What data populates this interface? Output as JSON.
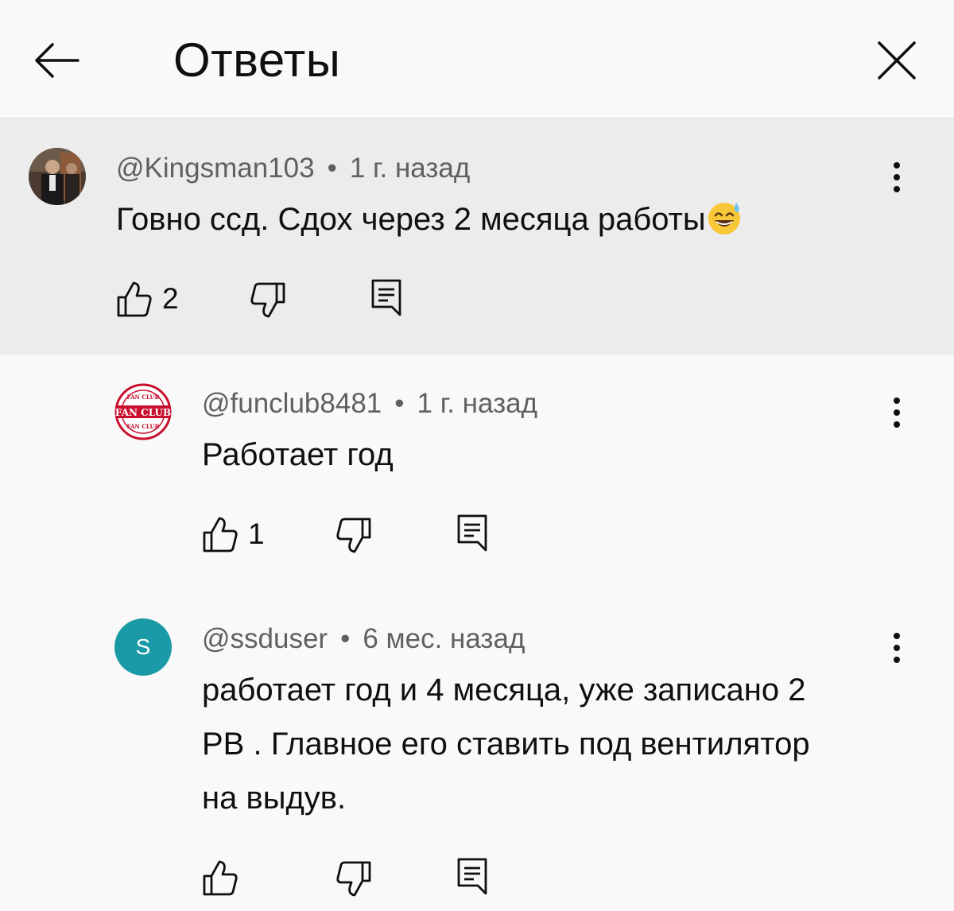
{
  "header": {
    "title": "Ответы"
  },
  "comments": [
    {
      "handle": "@Kingsman103",
      "separator": "•",
      "time": "1 г. назад",
      "text": "Говно ссд. Сдох через 2 месяца работы",
      "emoji": "😅",
      "likes": "2",
      "highlighted": true
    },
    {
      "handle": "@funclub8481",
      "separator": "•",
      "time": "1 г. назад",
      "text": "Работает год",
      "likes": "1",
      "avatar_text_top": "FAN CLUB",
      "avatar_text_main": "FAN CLUB",
      "avatar_text_bottom": "FAN CLUB"
    },
    {
      "handle": "@ssduser",
      "separator": "•",
      "time": "6 мес. назад",
      "text_lines": [
        "работает год и 4 месяца, уже записано 2",
        "PB . Главное его ставить под вентилятор",
        "на выдув."
      ],
      "likes": "",
      "avatar_letter": "S"
    }
  ],
  "colors": {
    "background": "#f9f9f9",
    "highlight": "#ececec",
    "meta_text": "#606060",
    "avatar_teal": "#1a9aa6",
    "fanclub_red": "#c8102e"
  },
  "icons": [
    "back-arrow-icon",
    "close-icon",
    "more-vert-icon",
    "thumb-up-icon",
    "thumb-down-icon",
    "reply-icon"
  ]
}
